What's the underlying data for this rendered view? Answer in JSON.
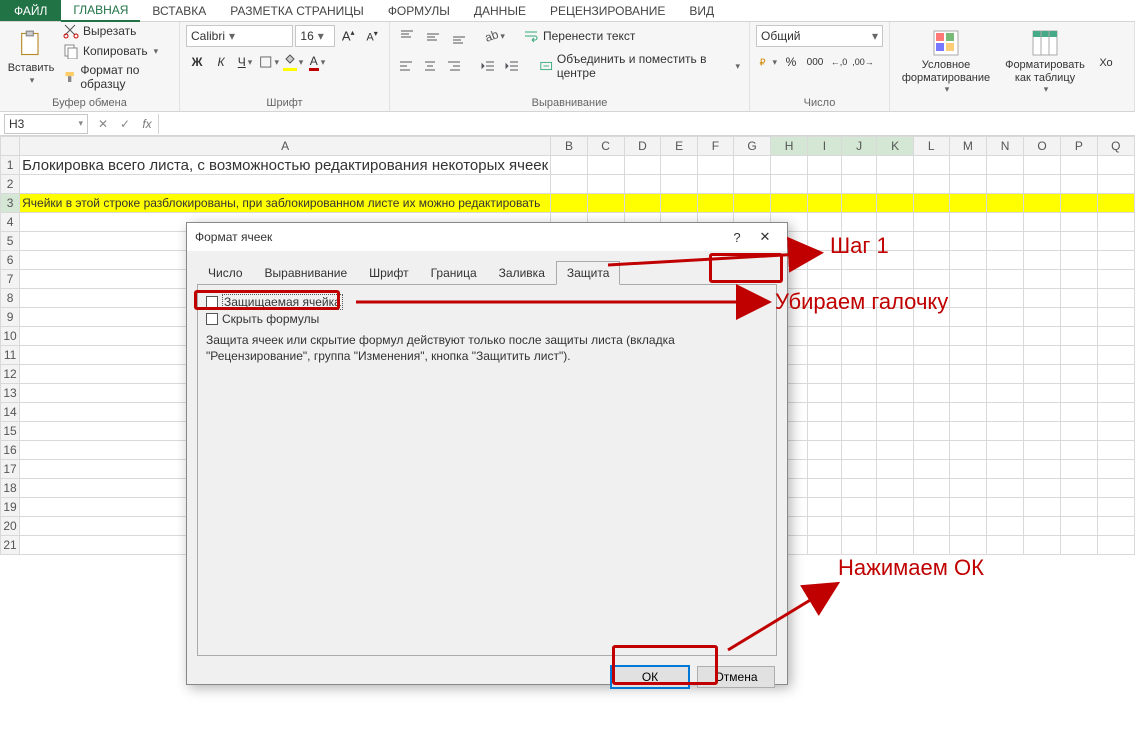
{
  "tabs": {
    "file": "ФАЙЛ",
    "items": [
      "ГЛАВНАЯ",
      "ВСТАВКА",
      "РАЗМЕТКА СТРАНИЦЫ",
      "ФОРМУЛЫ",
      "ДАННЫЕ",
      "РЕЦЕНЗИРОВАНИЕ",
      "ВИД"
    ],
    "active": 0
  },
  "ribbon": {
    "clipboard": {
      "paste": "Вставить",
      "cut": "Вырезать",
      "copy": "Копировать",
      "format_painter": "Формат по образцу",
      "label": "Буфер обмена"
    },
    "font": {
      "name": "Calibri",
      "size": "16",
      "bold": "Ж",
      "italic": "К",
      "underline": "Ч",
      "label": "Шрифт",
      "increase": "A",
      "decrease": "A"
    },
    "alignment": {
      "wrap": "Перенести текст",
      "merge": "Объединить и поместить в центре",
      "label": "Выравнивание"
    },
    "number": {
      "format": "Общий",
      "label": "Число",
      "percent": "%",
      "comma": "000",
      "inc": ",0",
      "dec": ",00"
    },
    "styles": {
      "cond": "Условное форматирование",
      "table": "Форматировать как таблицу",
      "cell": "Хо"
    }
  },
  "formula_bar": {
    "name_box": "H3",
    "fx": "fx",
    "value": ""
  },
  "grid": {
    "cols": [
      "A",
      "B",
      "C",
      "D",
      "E",
      "F",
      "G",
      "H",
      "I",
      "J",
      "K",
      "L",
      "M",
      "N",
      "O",
      "P",
      "Q"
    ],
    "row1_text": "Блокировка всего листа, с возможностью редактирования некоторых ячеек",
    "row3_text": "Ячейки в этой строке разблокированы, при заблокированном листе их можно редактировать",
    "row_count": 21
  },
  "dialog": {
    "title": "Формат ячеек",
    "help": "?",
    "close": "✕",
    "tabs": [
      "Число",
      "Выравнивание",
      "Шрифт",
      "Граница",
      "Заливка",
      "Защита"
    ],
    "active_tab": 5,
    "chk_locked": "Защищаемая ячейка",
    "chk_hidden": "Скрыть формулы",
    "hint": "Защита ячеек или скрытие формул действуют только после защиты листа (вкладка \"Рецензирование\", группа \"Изменения\", кнопка \"Защитить лист\").",
    "ok": "ОК",
    "cancel": "Отмена"
  },
  "annotations": {
    "step1": "Шаг 1",
    "remove_check": "Убираем галочку",
    "press_ok": "Нажимаем ОК"
  }
}
